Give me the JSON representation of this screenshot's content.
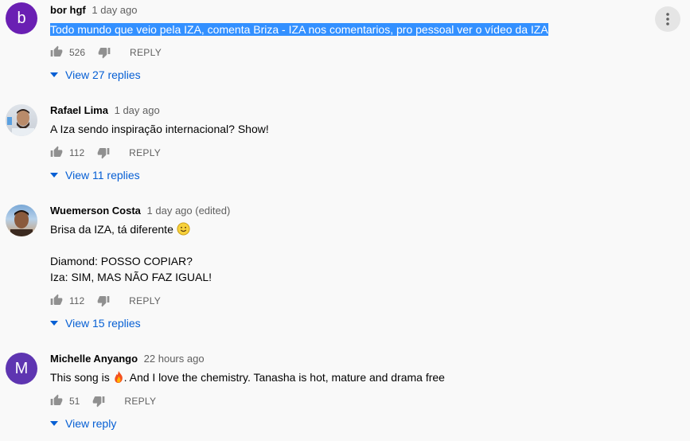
{
  "comments": [
    {
      "author": "bor hgf",
      "time": "1 day ago",
      "avatar_letter": "b",
      "lines": [
        "Todo mundo que veio pela IZA, comenta Briza - IZA nos comentarios, pro pessoal ver o vídeo da IZA"
      ],
      "likes": "526",
      "reply_label": "REPLY",
      "view_replies": "View 27 replies"
    },
    {
      "author": "Rafael Lima",
      "time": "1 day ago",
      "lines": [
        "A Iza sendo inspiração internacional? Show!"
      ],
      "likes": "112",
      "reply_label": "REPLY",
      "view_replies": "View 11 replies"
    },
    {
      "author": "Wuemerson Costa",
      "time": "1 day ago (edited)",
      "lines": [
        "Brisa da IZA, tá diferente",
        "Diamond: POSSO COPIAR?",
        "Iza: SIM, MAS NÃO FAZ IGUAL!"
      ],
      "likes": "112",
      "reply_label": "REPLY",
      "view_replies": "View 15 replies"
    },
    {
      "author": "Michelle Anyango",
      "time": "22 hours ago",
      "avatar_letter": "M",
      "lines_a": "This song is ",
      "lines_b": ". And I love the chemistry. Tanasha is hot, mature and drama free",
      "likes": "51",
      "reply_label": "REPLY",
      "view_replies": "View reply"
    }
  ],
  "icons": {
    "like": "thumb-up-icon",
    "dislike": "thumb-down-icon",
    "caret": "caret-down-icon",
    "menu": "more-vert-icon",
    "smile": "smiling-face-emoji",
    "fire": "fire-emoji"
  },
  "colors": {
    "accent_link": "#065fd4",
    "selection": "#3390ff",
    "avatar_b": "#6a1fb3",
    "avatar_m": "#5e35b1"
  }
}
